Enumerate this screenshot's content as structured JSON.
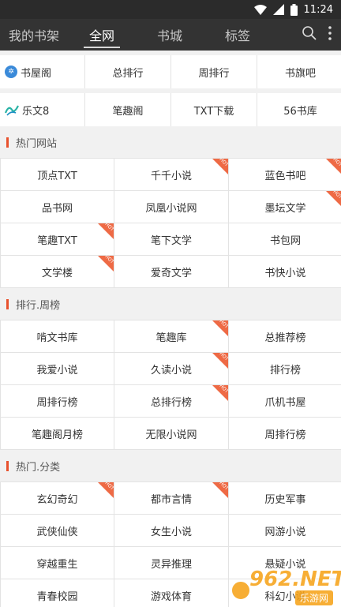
{
  "status": {
    "time": "11:24"
  },
  "tabs": [
    {
      "label": "我的书架"
    },
    {
      "label": "全网"
    },
    {
      "label": "书城"
    },
    {
      "label": "标签"
    }
  ],
  "colors": {
    "accent": "#e8512d",
    "hot": "#ee6a45",
    "nav_bg": "#333333"
  },
  "sites_row1": {
    "logo_name": "shuwuge-logo",
    "items": [
      "书屋阁",
      "总排行",
      "周排行",
      "书旗吧"
    ]
  },
  "sites_row2": {
    "logo_name": "lewen-logo",
    "items": [
      "乐文8",
      "笔趣阁",
      "TXT下载",
      "56书库"
    ]
  },
  "sections": [
    {
      "title": "热门网站",
      "items": [
        {
          "label": "顶点TXT",
          "hot": false
        },
        {
          "label": "千千小说",
          "hot": true
        },
        {
          "label": "蓝色书吧",
          "hot": true
        },
        {
          "label": "品书网",
          "hot": false
        },
        {
          "label": "凤凰小说网",
          "hot": false
        },
        {
          "label": "墨坛文学",
          "hot": true
        },
        {
          "label": "笔趣TXT",
          "hot": true
        },
        {
          "label": "笔下文学",
          "hot": false
        },
        {
          "label": "书包网",
          "hot": false
        },
        {
          "label": "文学楼",
          "hot": true
        },
        {
          "label": "爱奇文学",
          "hot": false
        },
        {
          "label": "书快小说",
          "hot": false
        }
      ]
    },
    {
      "title": "排行.周榜",
      "items": [
        {
          "label": "啃文书库",
          "hot": false
        },
        {
          "label": "笔趣库",
          "hot": true
        },
        {
          "label": "总推荐榜",
          "hot": false
        },
        {
          "label": "我爱小说",
          "hot": false
        },
        {
          "label": "久读小说",
          "hot": true
        },
        {
          "label": "排行榜",
          "hot": false
        },
        {
          "label": "周排行榜",
          "hot": false
        },
        {
          "label": "总排行榜",
          "hot": true
        },
        {
          "label": "爪机书屋",
          "hot": false
        },
        {
          "label": "笔趣阁月榜",
          "hot": false
        },
        {
          "label": "无限小说网",
          "hot": false
        },
        {
          "label": "周排行榜",
          "hot": false
        }
      ]
    },
    {
      "title": "热门.分类",
      "items": [
        {
          "label": "玄幻奇幻",
          "hot": true
        },
        {
          "label": "都市言情",
          "hot": true
        },
        {
          "label": "历史军事",
          "hot": false
        },
        {
          "label": "武侠仙侠",
          "hot": false
        },
        {
          "label": "女生小说",
          "hot": false
        },
        {
          "label": "网游小说",
          "hot": false
        },
        {
          "label": "穿越重生",
          "hot": false
        },
        {
          "label": "灵异推理",
          "hot": false
        },
        {
          "label": "悬疑小说",
          "hot": false
        },
        {
          "label": "青春校园",
          "hot": false
        },
        {
          "label": "游戏体育",
          "hot": false
        },
        {
          "label": "科幻小说",
          "hot": false
        }
      ]
    }
  ],
  "watermark": {
    "main": "962.NET",
    "sub": "乐游网"
  }
}
